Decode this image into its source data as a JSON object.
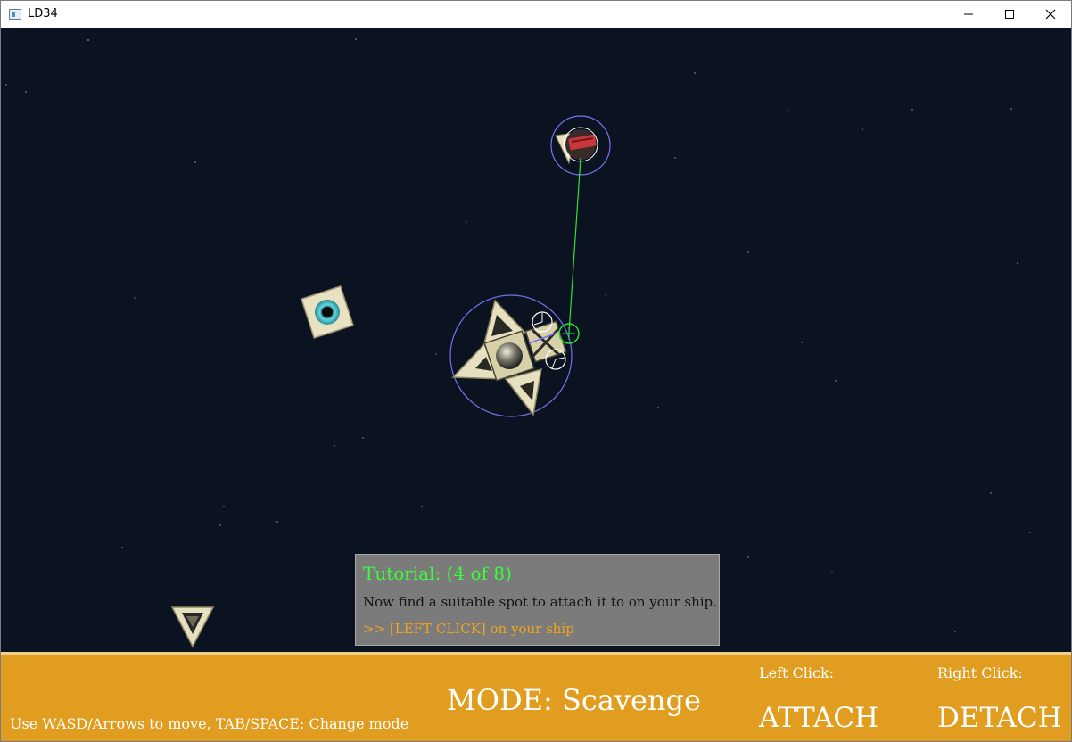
{
  "window": {
    "title": "LD34",
    "icon": "app-window-icon",
    "controls": [
      "minimize-icon",
      "maximize-icon",
      "close-icon"
    ]
  },
  "scene": {
    "background_color": "#0b1320",
    "objects": [
      "player-ship",
      "target-part",
      "eye-module-part",
      "loose-triangle-part"
    ]
  },
  "tutorial": {
    "title": "Tutorial:  (4 of 8)",
    "body": "Now find a suitable spot to attach it to on your ship.",
    "action": ">> [LEFT CLICK] on your ship",
    "title_color": "#39ff3a",
    "action_color": "#f2a21c"
  },
  "hud": {
    "help_text": "Use WASD/Arrows to move, TAB/SPACE: Change mode",
    "mode": "MODE: Scavenge",
    "left_click_label": "Left Click:",
    "left_click_action": "ATTACH",
    "right_click_label": "Right Click:",
    "right_click_action": "DETACH",
    "color": "#e19d1f"
  }
}
